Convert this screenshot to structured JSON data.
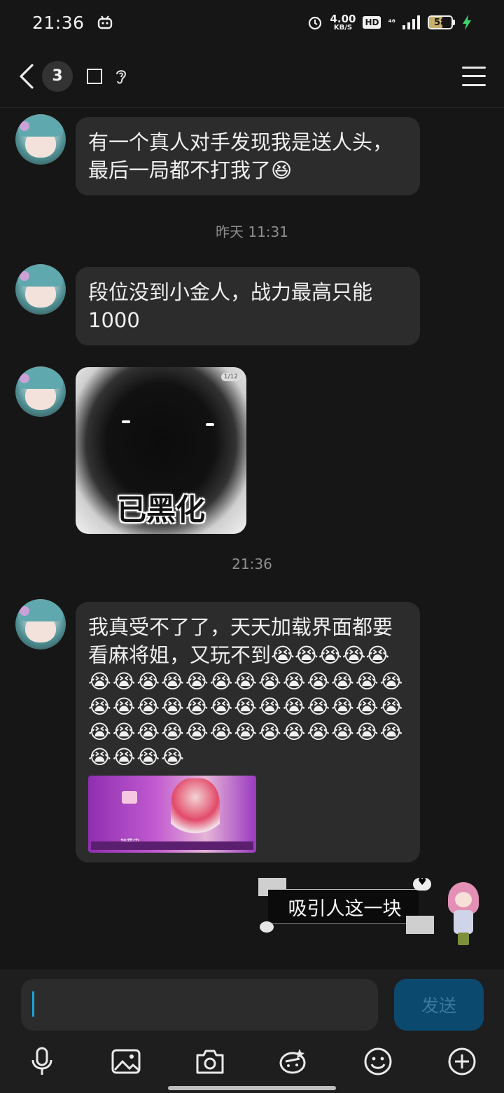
{
  "status_bar": {
    "time": "21:36",
    "net_speed_value": "4.00",
    "net_speed_unit": "KB/S",
    "hd_label": "HD",
    "network_type": "⁴⁶",
    "battery_level": "58",
    "icons": [
      "app-notification-icon",
      "alarm-icon",
      "hd-icon",
      "signal-icon",
      "battery-icon",
      "charging-icon"
    ]
  },
  "title_bar": {
    "unread_count": "3",
    "icons": [
      "back-icon",
      "square-icon",
      "ear-icon",
      "menu-icon"
    ]
  },
  "messages": [
    {
      "type": "text",
      "sender": "other",
      "text": "有一个真人对手发现我是送人头，最后一局都不打我了😆"
    },
    {
      "type": "timestamp",
      "text": "昨天 11:31"
    },
    {
      "type": "text",
      "sender": "other",
      "text": "段位没到小金人，战力最高只能1000"
    },
    {
      "type": "image",
      "sender": "other",
      "caption": "已黑化",
      "page_tag": "1/12"
    },
    {
      "type": "timestamp",
      "text": "21:36"
    },
    {
      "type": "text_with_image",
      "sender": "other",
      "text": "我真受不了了，天天加载界面都要看麻将姐，又玩不到😭😭😭😭😭",
      "emoji_rows": [
        "😭😭😭😭😭😭😭😭😭😭😭😭😭",
        "😭😭😭😭😭😭😭😭😭😭😭😭😭",
        "😭😭😭😭😭😭😭😭😭😭😭😭😭",
        "😭😭😭😭"
      ],
      "inline_loading_text": "加载中..."
    },
    {
      "type": "sticker_text",
      "sender": "self",
      "text": "吸引人这一块"
    }
  ],
  "input_bar": {
    "value": "",
    "send_label": "发送"
  },
  "toolbar": {
    "icons": [
      "microphone-icon",
      "image-icon",
      "camera-icon",
      "sticker-icon",
      "emoji-icon",
      "plus-icon"
    ]
  },
  "colors": {
    "background": "#161616",
    "bubble": "#2c2c2c",
    "send_button": "#0b4a6e",
    "caret": "#1aa5d8"
  }
}
